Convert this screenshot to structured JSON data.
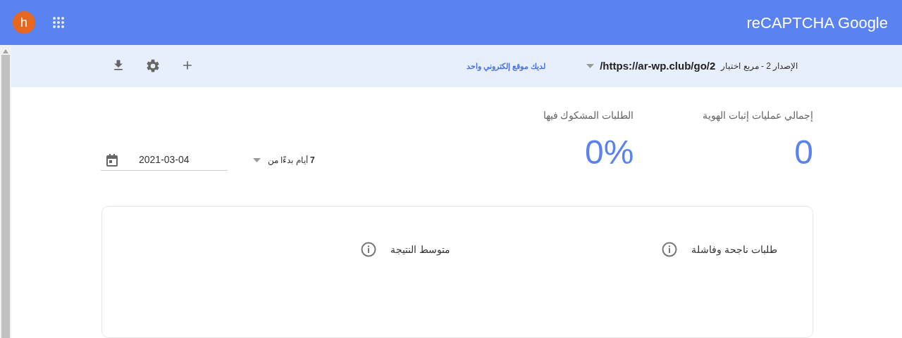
{
  "header": {
    "avatar_letter": "h",
    "brand": "reCAPTCHA Google"
  },
  "toolbar": {
    "site_type": "الإصدار 2 - مربع اختيار",
    "site_url": "/https://ar-wp.club/go/2",
    "link": "لديك موقع إلكتروني واحد"
  },
  "stats": [
    {
      "label": "إجمالي عمليات إثبات الهوية",
      "value": "0"
    },
    {
      "label": "الطلبات المشكوك فيها",
      "value": "0%"
    }
  ],
  "range": {
    "label_count": "7",
    "label_text": "أيام بدءًا من",
    "date": "2021-03-04"
  },
  "panels": [
    {
      "title": "طلبات ناجحة وفاشلة"
    },
    {
      "title": "متوسط النتيجة"
    }
  ]
}
